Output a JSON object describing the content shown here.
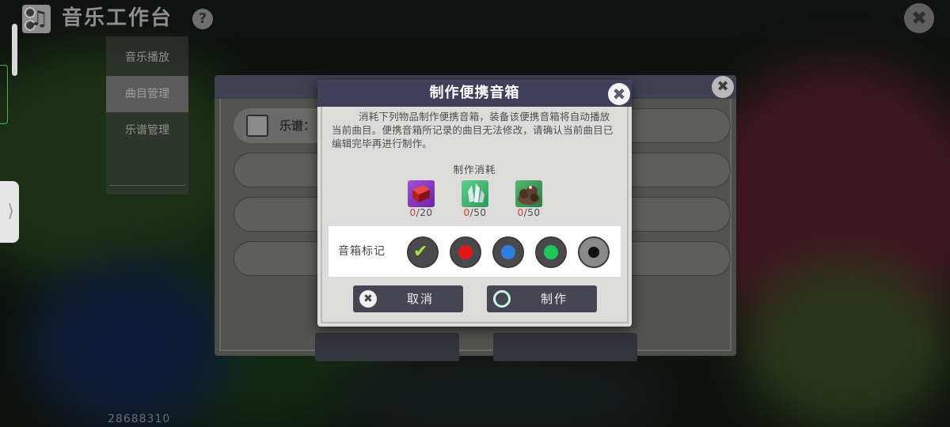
{
  "app": {
    "title": "音乐工作台",
    "help_icon": "question-mark",
    "close_icon": "close-x"
  },
  "menu": {
    "items": [
      {
        "label": "音乐播放",
        "active": false
      },
      {
        "label": "曲目管理",
        "active": true
      },
      {
        "label": "乐谱管理",
        "active": false
      }
    ]
  },
  "background_panel": {
    "score_label": "乐谱：",
    "close_icon": "close-x"
  },
  "user_id": "28688310",
  "dialog": {
    "title": "制作便携音箱",
    "description": "消耗下列物品制作便携音箱，装备该便携音箱将自动播放当前曲目。便携音箱所记录的曲目无法修改，请确认当前曲目已编辑完毕再进行制作。",
    "cost_title": "制作消耗",
    "materials": [
      {
        "icon": "red-crate-icon",
        "have": "0",
        "need": "/20"
      },
      {
        "icon": "crystal-icon",
        "have": "0",
        "need": "/50"
      },
      {
        "icon": "ore-pile-icon",
        "have": "0",
        "need": "/50"
      }
    ],
    "marker_label": "音箱标记",
    "markers": [
      {
        "name": "marker-selected",
        "color": "#7ccf3a",
        "selected": true
      },
      {
        "name": "marker-red",
        "color": "#e01818",
        "selected": false
      },
      {
        "name": "marker-blue",
        "color": "#2f7fe0",
        "selected": false
      },
      {
        "name": "marker-green",
        "color": "#22c75a",
        "selected": false
      },
      {
        "name": "marker-black",
        "color": "#111111",
        "selected": false
      }
    ],
    "cancel_label": "取消",
    "confirm_label": "制作"
  },
  "colors": {
    "header": "#40405a",
    "button": "#464652",
    "dialog_bg": "#dcdcda",
    "shortage": "#d43b3b"
  }
}
